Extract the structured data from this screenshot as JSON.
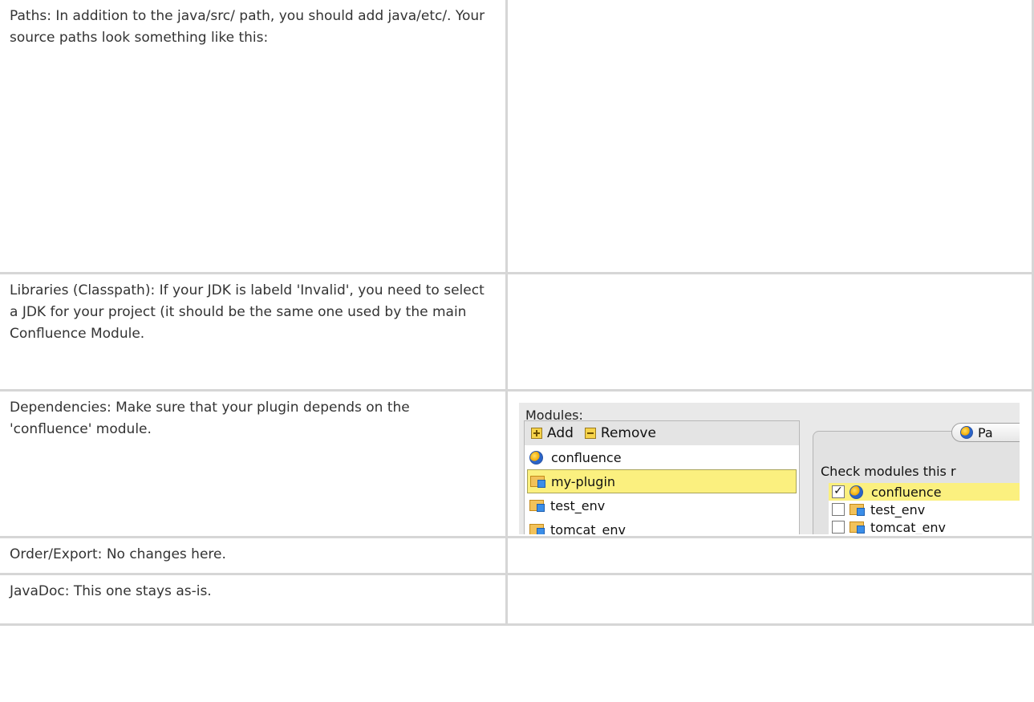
{
  "rows": [
    {
      "text": "Paths: In addition to the java/src/ path, you should add java/etc/. Your source paths look something like this:"
    },
    {
      "text": "Libraries (Classpath): If your JDK is labeld 'Invalid', you need to select a JDK for your project (it should be the same one used by the main Confluence Module."
    },
    {
      "text": "Dependencies: Make sure that your plugin depends on the 'confluence' module."
    },
    {
      "text": "Order/Export: No changes here."
    },
    {
      "text": "JavaDoc: This one stays as-is."
    }
  ],
  "screenshot": {
    "modules_label": "Modules:",
    "add_label": "Add",
    "remove_label": "Remove",
    "modules": [
      {
        "name": "confluence",
        "icon": "globe-icon"
      },
      {
        "name": "my-plugin",
        "icon": "folder-icon",
        "selected": true
      },
      {
        "name": "test_env",
        "icon": "folder-icon"
      },
      {
        "name": "tomcat_env",
        "icon": "folder-icon"
      }
    ],
    "tab_label": "Pa",
    "check_label": "Check modules this r",
    "dependencies": [
      {
        "name": "confluence",
        "checked": true,
        "icon": "globe-icon"
      },
      {
        "name": "test_env",
        "checked": false,
        "icon": "folder-icon"
      },
      {
        "name": "tomcat_env",
        "checked": false,
        "icon": "folder-icon"
      }
    ]
  }
}
